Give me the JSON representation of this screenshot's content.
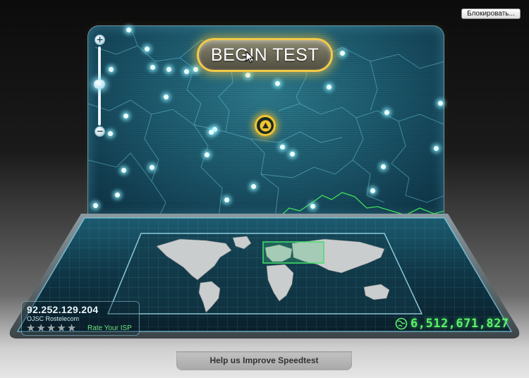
{
  "browser": {
    "block_button_label": "Блокировать..."
  },
  "map": {
    "zoom_in_label": "+",
    "zoom_out_label": "−",
    "begin_test_label": "BEGIN TEST",
    "server_pin_icon": "triangle-up-icon"
  },
  "connection": {
    "ip_address": "92.252.129.204",
    "isp": "OJSC Rostelecom",
    "rating_stars": [
      "★",
      "★",
      "★",
      "★",
      "★"
    ],
    "rating_value": 0,
    "rate_link": "Rate Your ISP"
  },
  "stats": {
    "counter_icon": "globe-icon",
    "tests_count": "6,512,671,827"
  },
  "footer": {
    "help_label": "Help us Improve Speedtest"
  },
  "colors": {
    "accent_gold": "#f3c948",
    "counter_green": "#5cf06a",
    "map_teal": "#1d5a6e"
  }
}
